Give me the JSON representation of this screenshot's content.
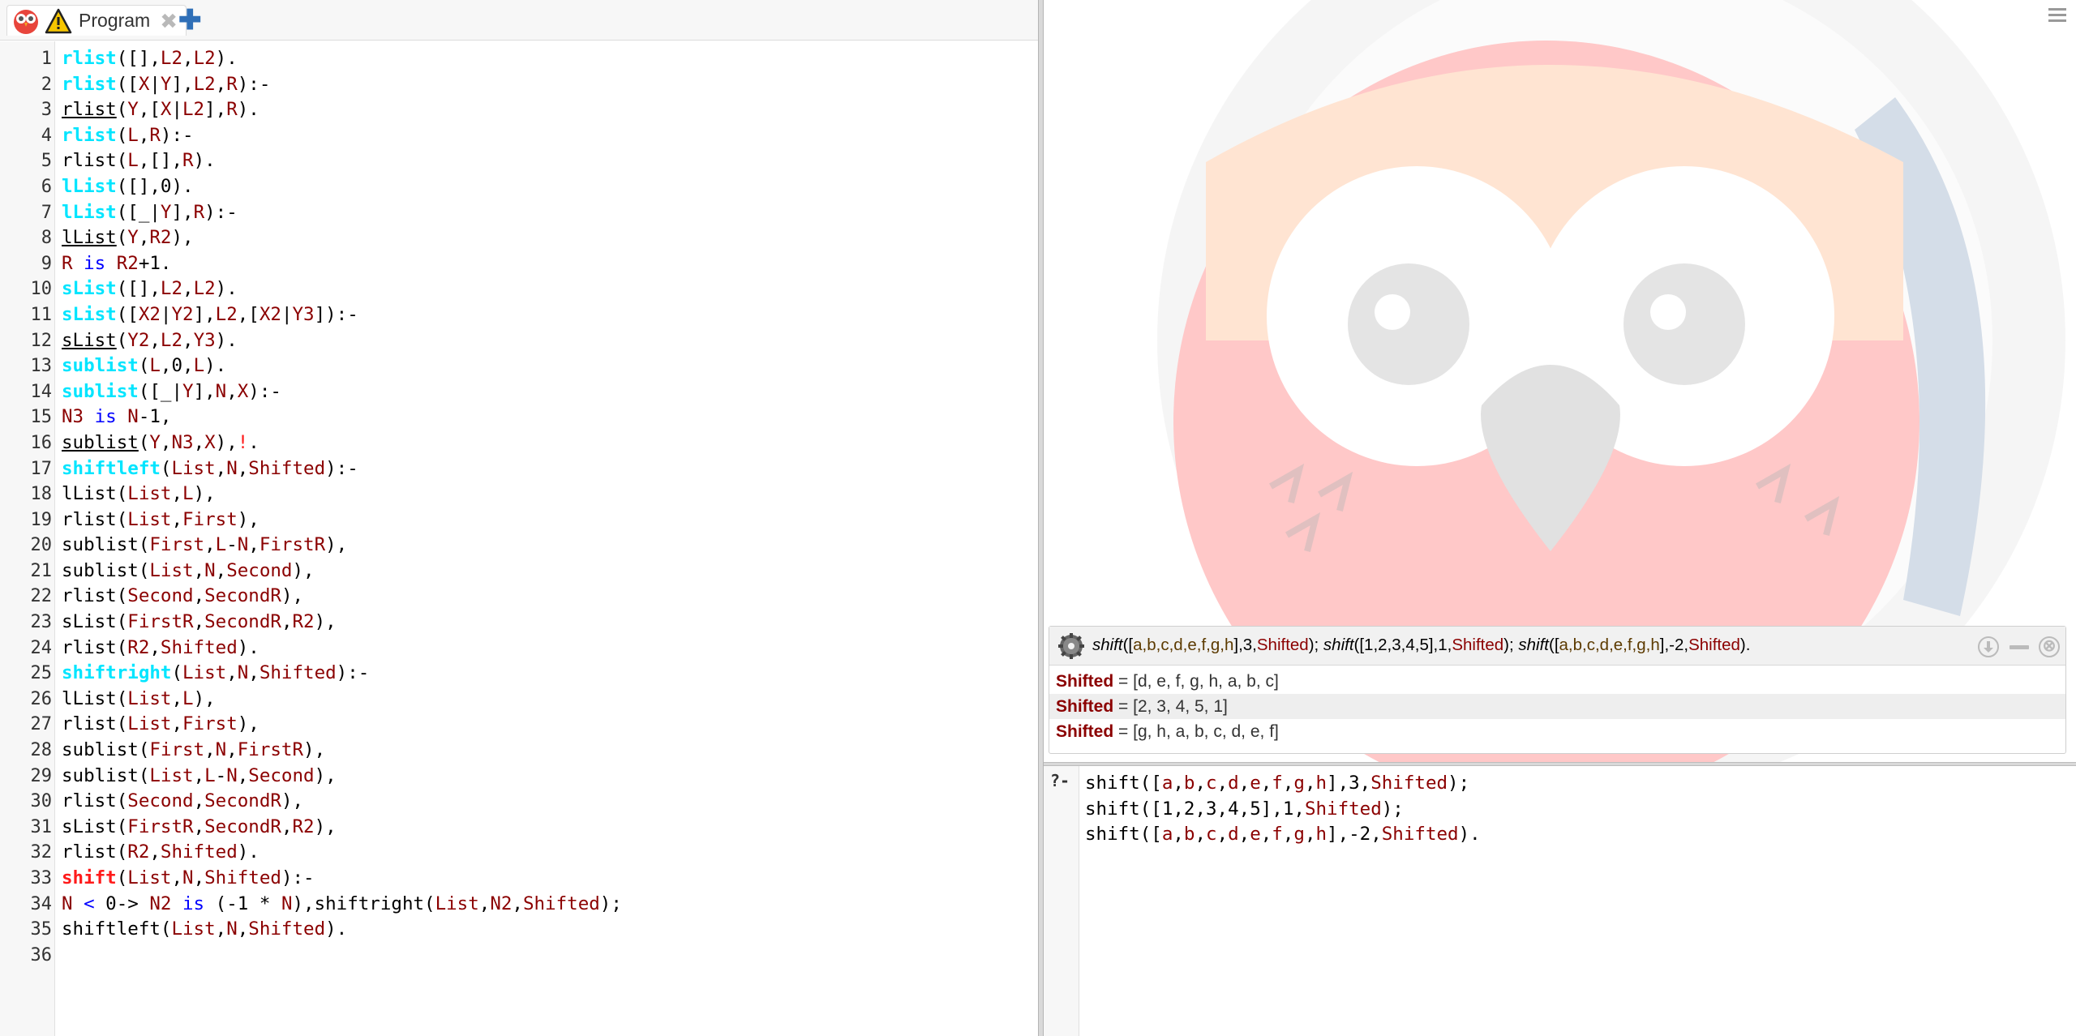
{
  "tab": {
    "label": "Program",
    "close_glyph": "✖",
    "add_glyph": "✚",
    "icons": [
      "swish-owl-icon",
      "warning-icon"
    ]
  },
  "editor": {
    "lines": [
      [
        {
          "t": "rlist",
          "c": "head"
        },
        {
          "t": "([],"
        },
        {
          "t": "L2",
          "c": "var"
        },
        {
          "t": ","
        },
        {
          "t": "L2",
          "c": "var"
        },
        {
          "t": ")."
        }
      ],
      [
        {
          "t": "rlist",
          "c": "head"
        },
        {
          "t": "(["
        },
        {
          "t": "X",
          "c": "var"
        },
        {
          "t": "|"
        },
        {
          "t": "Y",
          "c": "var"
        },
        {
          "t": "],"
        },
        {
          "t": "L2",
          "c": "var"
        },
        {
          "t": ","
        },
        {
          "t": "R",
          "c": "var"
        },
        {
          "t": "):-"
        }
      ],
      [
        {
          "t": "rlist",
          "c": "ul"
        },
        {
          "t": "("
        },
        {
          "t": "Y",
          "c": "var"
        },
        {
          "t": ",["
        },
        {
          "t": "X",
          "c": "var"
        },
        {
          "t": "|"
        },
        {
          "t": "L2",
          "c": "var"
        },
        {
          "t": "],"
        },
        {
          "t": "R",
          "c": "var"
        },
        {
          "t": ")."
        }
      ],
      [
        {
          "t": "rlist",
          "c": "head"
        },
        {
          "t": "("
        },
        {
          "t": "L",
          "c": "var"
        },
        {
          "t": ","
        },
        {
          "t": "R",
          "c": "var"
        },
        {
          "t": "):-"
        }
      ],
      [
        {
          "t": "rlist("
        },
        {
          "t": "L",
          "c": "var"
        },
        {
          "t": ",[],"
        },
        {
          "t": "R",
          "c": "var"
        },
        {
          "t": ")."
        }
      ],
      [
        {
          "t": "lList",
          "c": "head"
        },
        {
          "t": "([],0)."
        }
      ],
      [
        {
          "t": "lList",
          "c": "head"
        },
        {
          "t": "([_|"
        },
        {
          "t": "Y",
          "c": "var"
        },
        {
          "t": "],"
        },
        {
          "t": "R",
          "c": "var"
        },
        {
          "t": "):-"
        }
      ],
      [
        {
          "t": "lList",
          "c": "ul"
        },
        {
          "t": "("
        },
        {
          "t": "Y",
          "c": "var"
        },
        {
          "t": ","
        },
        {
          "t": "R2",
          "c": "var"
        },
        {
          "t": "),"
        }
      ],
      [
        {
          "t": "R",
          "c": "var"
        },
        {
          "t": " "
        },
        {
          "t": "is",
          "c": "op"
        },
        {
          "t": " "
        },
        {
          "t": "R2",
          "c": "var"
        },
        {
          "t": "+1."
        }
      ],
      [
        {
          "t": "sList",
          "c": "head"
        },
        {
          "t": "([],"
        },
        {
          "t": "L2",
          "c": "var"
        },
        {
          "t": ","
        },
        {
          "t": "L2",
          "c": "var"
        },
        {
          "t": ")."
        }
      ],
      [
        {
          "t": "sList",
          "c": "head"
        },
        {
          "t": "(["
        },
        {
          "t": "X2",
          "c": "var"
        },
        {
          "t": "|"
        },
        {
          "t": "Y2",
          "c": "var"
        },
        {
          "t": "],"
        },
        {
          "t": "L2",
          "c": "var"
        },
        {
          "t": ",["
        },
        {
          "t": "X2",
          "c": "var"
        },
        {
          "t": "|"
        },
        {
          "t": "Y3",
          "c": "var"
        },
        {
          "t": "]):-"
        }
      ],
      [
        {
          "t": "sList",
          "c": "ul"
        },
        {
          "t": "("
        },
        {
          "t": "Y2",
          "c": "var"
        },
        {
          "t": ","
        },
        {
          "t": "L2",
          "c": "var"
        },
        {
          "t": ","
        },
        {
          "t": "Y3",
          "c": "var"
        },
        {
          "t": ")."
        }
      ],
      [
        {
          "t": "sublist",
          "c": "head"
        },
        {
          "t": "("
        },
        {
          "t": "L",
          "c": "var"
        },
        {
          "t": ",0,"
        },
        {
          "t": "L",
          "c": "var"
        },
        {
          "t": ")."
        }
      ],
      [
        {
          "t": "sublist",
          "c": "head"
        },
        {
          "t": "([_|"
        },
        {
          "t": "Y",
          "c": "var"
        },
        {
          "t": "],"
        },
        {
          "t": "N",
          "c": "var"
        },
        {
          "t": ","
        },
        {
          "t": "X",
          "c": "var"
        },
        {
          "t": "):-"
        }
      ],
      [
        {
          "t": "N3",
          "c": "var"
        },
        {
          "t": " "
        },
        {
          "t": "is",
          "c": "op"
        },
        {
          "t": " "
        },
        {
          "t": "N",
          "c": "var"
        },
        {
          "t": "-1,"
        }
      ],
      [
        {
          "t": "sublist",
          "c": "ul"
        },
        {
          "t": "("
        },
        {
          "t": "Y",
          "c": "var"
        },
        {
          "t": ","
        },
        {
          "t": "N3",
          "c": "var"
        },
        {
          "t": ","
        },
        {
          "t": "X",
          "c": "var"
        },
        {
          "t": "),"
        },
        {
          "t": "!",
          "c": "cut"
        },
        {
          "t": "."
        }
      ],
      [
        {
          "t": "shiftleft",
          "c": "head"
        },
        {
          "t": "("
        },
        {
          "t": "List",
          "c": "var"
        },
        {
          "t": ","
        },
        {
          "t": "N",
          "c": "var"
        },
        {
          "t": ","
        },
        {
          "t": "Shifted",
          "c": "var"
        },
        {
          "t": "):-"
        }
      ],
      [
        {
          "t": "lList("
        },
        {
          "t": "List",
          "c": "var"
        },
        {
          "t": ","
        },
        {
          "t": "L",
          "c": "var"
        },
        {
          "t": "),"
        }
      ],
      [
        {
          "t": "rlist("
        },
        {
          "t": "List",
          "c": "var"
        },
        {
          "t": ","
        },
        {
          "t": "First",
          "c": "var"
        },
        {
          "t": "),"
        }
      ],
      [
        {
          "t": "sublist("
        },
        {
          "t": "First",
          "c": "var"
        },
        {
          "t": ","
        },
        {
          "t": "L",
          "c": "var"
        },
        {
          "t": "-"
        },
        {
          "t": "N",
          "c": "var"
        },
        {
          "t": ","
        },
        {
          "t": "FirstR",
          "c": "var"
        },
        {
          "t": "),"
        }
      ],
      [
        {
          "t": "sublist("
        },
        {
          "t": "List",
          "c": "var"
        },
        {
          "t": ","
        },
        {
          "t": "N",
          "c": "var"
        },
        {
          "t": ","
        },
        {
          "t": "Second",
          "c": "var"
        },
        {
          "t": "),"
        }
      ],
      [
        {
          "t": "rlist("
        },
        {
          "t": "Second",
          "c": "var"
        },
        {
          "t": ","
        },
        {
          "t": "SecondR",
          "c": "var"
        },
        {
          "t": "),"
        }
      ],
      [
        {
          "t": "sList("
        },
        {
          "t": "FirstR",
          "c": "var"
        },
        {
          "t": ","
        },
        {
          "t": "SecondR",
          "c": "var"
        },
        {
          "t": ","
        },
        {
          "t": "R2",
          "c": "var"
        },
        {
          "t": "),"
        }
      ],
      [
        {
          "t": "rlist("
        },
        {
          "t": "R2",
          "c": "var"
        },
        {
          "t": ","
        },
        {
          "t": "Shifted",
          "c": "var"
        },
        {
          "t": ")."
        }
      ],
      [
        {
          "t": "shiftright",
          "c": "head"
        },
        {
          "t": "("
        },
        {
          "t": "List",
          "c": "var"
        },
        {
          "t": ","
        },
        {
          "t": "N",
          "c": "var"
        },
        {
          "t": ","
        },
        {
          "t": "Shifted",
          "c": "var"
        },
        {
          "t": "):-"
        }
      ],
      [
        {
          "t": "lList("
        },
        {
          "t": "List",
          "c": "var"
        },
        {
          "t": ","
        },
        {
          "t": "L",
          "c": "var"
        },
        {
          "t": "),"
        }
      ],
      [
        {
          "t": "rlist("
        },
        {
          "t": "List",
          "c": "var"
        },
        {
          "t": ","
        },
        {
          "t": "First",
          "c": "var"
        },
        {
          "t": "),"
        }
      ],
      [
        {
          "t": "sublist("
        },
        {
          "t": "First",
          "c": "var"
        },
        {
          "t": ","
        },
        {
          "t": "N",
          "c": "var"
        },
        {
          "t": ","
        },
        {
          "t": "FirstR",
          "c": "var"
        },
        {
          "t": "),"
        }
      ],
      [
        {
          "t": "sublist("
        },
        {
          "t": "List",
          "c": "var"
        },
        {
          "t": ","
        },
        {
          "t": "L",
          "c": "var"
        },
        {
          "t": "-"
        },
        {
          "t": "N",
          "c": "var"
        },
        {
          "t": ","
        },
        {
          "t": "Second",
          "c": "var"
        },
        {
          "t": "),"
        }
      ],
      [
        {
          "t": "rlist("
        },
        {
          "t": "Second",
          "c": "var"
        },
        {
          "t": ","
        },
        {
          "t": "SecondR",
          "c": "var"
        },
        {
          "t": "),"
        }
      ],
      [
        {
          "t": "sList("
        },
        {
          "t": "FirstR",
          "c": "var"
        },
        {
          "t": ","
        },
        {
          "t": "SecondR",
          "c": "var"
        },
        {
          "t": ","
        },
        {
          "t": "R2",
          "c": "var"
        },
        {
          "t": "),"
        }
      ],
      [
        {
          "t": "rlist("
        },
        {
          "t": "R2",
          "c": "var"
        },
        {
          "t": ","
        },
        {
          "t": "Shifted",
          "c": "var"
        },
        {
          "t": ")."
        }
      ],
      [
        {
          "t": "shift",
          "c": "headred"
        },
        {
          "t": "("
        },
        {
          "t": "List",
          "c": "var"
        },
        {
          "t": ","
        },
        {
          "t": "N",
          "c": "var"
        },
        {
          "t": ","
        },
        {
          "t": "Shifted",
          "c": "var"
        },
        {
          "t": "):-"
        }
      ],
      [
        {
          "t": "N",
          "c": "var"
        },
        {
          "t": " "
        },
        {
          "t": "<",
          "c": "op"
        },
        {
          "t": " 0-> "
        },
        {
          "t": "N2",
          "c": "var"
        },
        {
          "t": " "
        },
        {
          "t": "is",
          "c": "op"
        },
        {
          "t": " (-1 * "
        },
        {
          "t": "N",
          "c": "var"
        },
        {
          "t": "),shiftright("
        },
        {
          "t": "List",
          "c": "var"
        },
        {
          "t": ","
        },
        {
          "t": "N2",
          "c": "var"
        },
        {
          "t": ","
        },
        {
          "t": "Shifted",
          "c": "var"
        },
        {
          "t": ");"
        }
      ],
      [
        {
          "t": "shiftleft("
        },
        {
          "t": "List",
          "c": "var"
        },
        {
          "t": ","
        },
        {
          "t": "N",
          "c": "var"
        },
        {
          "t": ","
        },
        {
          "t": "Shifted",
          "c": "var"
        },
        {
          "t": ")."
        }
      ],
      []
    ]
  },
  "query_panel": {
    "query": [
      {
        "t": "shift",
        "c": "i"
      },
      {
        "t": "(["
      },
      {
        "t": "a,b,c,d,e,f,g,h",
        "c": "atom"
      },
      {
        "t": "],3,"
      },
      {
        "t": "Shifted",
        "c": "var"
      },
      {
        "t": "); "
      },
      {
        "t": "shift",
        "c": "i"
      },
      {
        "t": "([1,2,3,4,5],1,"
      },
      {
        "t": "Shifted",
        "c": "var"
      },
      {
        "t": "); "
      },
      {
        "t": "shift",
        "c": "i"
      },
      {
        "t": "(["
      },
      {
        "t": "a,b,c,d,e,f,g,h",
        "c": "atom"
      },
      {
        "t": "],-2,"
      },
      {
        "t": "Shifted",
        "c": "var"
      },
      {
        "t": ")."
      }
    ],
    "answers": [
      {
        "var": "Shifted",
        "value": " = [d, e, f, g, h, a, b, c]"
      },
      {
        "var": "Shifted",
        "value": " = [2, 3, 4, 5, 1]"
      },
      {
        "var": "Shifted",
        "value": " = [g, h, a, b, c, d, e, f]"
      }
    ],
    "close_glyph": "⊗"
  },
  "query_editor": {
    "prompt": "?-",
    "lines": [
      [
        {
          "t": "shift(["
        },
        {
          "t": "a",
          "c": "var"
        },
        {
          "t": ","
        },
        {
          "t": "b",
          "c": "var"
        },
        {
          "t": ","
        },
        {
          "t": "c",
          "c": "var"
        },
        {
          "t": ","
        },
        {
          "t": "d",
          "c": "var"
        },
        {
          "t": ","
        },
        {
          "t": "e",
          "c": "var"
        },
        {
          "t": ","
        },
        {
          "t": "f",
          "c": "var"
        },
        {
          "t": ","
        },
        {
          "t": "g",
          "c": "var"
        },
        {
          "t": ","
        },
        {
          "t": "h",
          "c": "var"
        },
        {
          "t": "],3,"
        },
        {
          "t": "Shifted",
          "c": "var"
        },
        {
          "t": ");"
        }
      ],
      [
        {
          "t": "shift([1,2,3,4,5],1,"
        },
        {
          "t": "Shifted",
          "c": "var"
        },
        {
          "t": ");"
        }
      ],
      [
        {
          "t": "shift(["
        },
        {
          "t": "a",
          "c": "var"
        },
        {
          "t": ","
        },
        {
          "t": "b",
          "c": "var"
        },
        {
          "t": ","
        },
        {
          "t": "c",
          "c": "var"
        },
        {
          "t": ","
        },
        {
          "t": "d",
          "c": "var"
        },
        {
          "t": ","
        },
        {
          "t": "e",
          "c": "var"
        },
        {
          "t": ","
        },
        {
          "t": "f",
          "c": "var"
        },
        {
          "t": ","
        },
        {
          "t": "g",
          "c": "var"
        },
        {
          "t": ","
        },
        {
          "t": "h",
          "c": "var"
        },
        {
          "t": "],-2,"
        },
        {
          "t": "Shifted",
          "c": "var"
        },
        {
          "t": ")."
        }
      ]
    ]
  }
}
